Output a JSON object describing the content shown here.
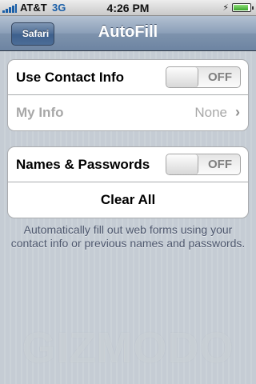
{
  "status_bar": {
    "carrier": "AT&T",
    "network": "3G",
    "time": "4:26 PM"
  },
  "nav": {
    "back_label": "Safari",
    "title": "AutoFill"
  },
  "group1": {
    "use_contact_info": {
      "label": "Use Contact Info",
      "toggle": "OFF"
    },
    "my_info": {
      "label": "My Info",
      "value": "None"
    }
  },
  "group2": {
    "names_passwords": {
      "label": "Names & Passwords",
      "toggle": "OFF"
    },
    "clear_all": {
      "label": "Clear All"
    }
  },
  "footer_note": "Automatically fill out web forms using your contact info or previous names and passwords.",
  "watermark": "GIZMODO",
  "icons": {
    "signal": "signal-bars-icon",
    "battery": "battery-charging-icon",
    "chevron": "chevron-right-icon"
  }
}
